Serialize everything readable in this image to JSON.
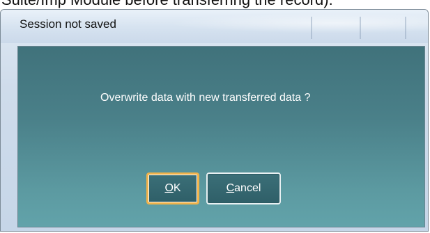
{
  "background": {
    "caption": "Suite/Imp Module before transferring the record)."
  },
  "dialog": {
    "title": "Session not saved",
    "message": "Overwrite data with new transferred data ?",
    "buttons": {
      "ok": {
        "mnemonic": "O",
        "rest": "K"
      },
      "cancel": {
        "mnemonic": "C",
        "rest": "ancel"
      }
    }
  },
  "colors": {
    "title_bar": "#d4e1ef",
    "client_top": "#40727b",
    "client_bottom": "#62a3aa",
    "button_fill": "#35656e",
    "default_button_border": "#f0b24a",
    "text_light": "#ffffff"
  }
}
